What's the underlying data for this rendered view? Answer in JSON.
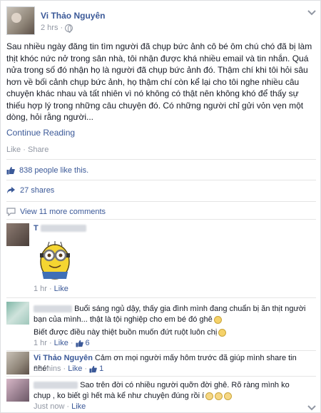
{
  "post": {
    "author": "Vi Thảo Nguyên",
    "time": "2 hrs",
    "text": "Sau nhiều ngày đăng tin tìm người đã chụp bức ảnh cô bé ôm chú chó đã bị làm thịt khóc nức nở trong sân nhà, tôi nhận được khá nhiều email và tin nhắn. Quá nửa trong số đó nhận họ là người đã chụp bức ảnh đó. Thậm chí khi tôi hỏi sâu hơn về bối cảnh chụp bức ảnh, họ thậm chí còn kể lại cho tôi nghe nhiều câu chuyện khác nhau và tất nhiên vì nó không có thật nên không khó để thấy sự thiếu hợp lý trong những câu chuyện đó. Có những người chỉ gửi vỏn vẹn một dòng, hỏi rằng người...",
    "continue_label": "Continue Reading",
    "like_label": "Like",
    "dot": "·",
    "share_label": "Share",
    "likes_text": "838 people like this.",
    "shares_text": "27 shares",
    "view_more": "View 11 more comments"
  },
  "comments": [
    {
      "initial": "T",
      "time": "1 hr",
      "like_label": "Like",
      "sticker": "minion-sticker"
    },
    {
      "text_line1": "Buổi sáng ngủ dậy, thấy gia đình mình đang chuẩn bị ăn thịt người",
      "text_line2": "bạn của mình... thật là tội nghiệp cho em bé đó ghê",
      "text_line3": "Biết được điều này thiệt buồn muốn đứt ruột luôn chị",
      "time": "1 hr",
      "like_label": "Like",
      "like_count": "6"
    },
    {
      "author": "Vi Thảo Nguyên",
      "text": "Cảm ơn mọi người mấy hôm trước đã giúp mình share tin nhé!",
      "time": "33 mins",
      "like_label": "Like",
      "like_count": "1"
    },
    {
      "text_line1": "Sao trên đời có nhiều người quỡn đời ghê. Rõ ràng mình ko",
      "text_line2": "chụp , ko biết gì hết mà kể như chuyện đúng rồi í",
      "time": "Just now",
      "like_label": "Like"
    }
  ],
  "colors": {
    "link": "#3b5998",
    "meta": "#9197a3",
    "text": "#141823"
  }
}
